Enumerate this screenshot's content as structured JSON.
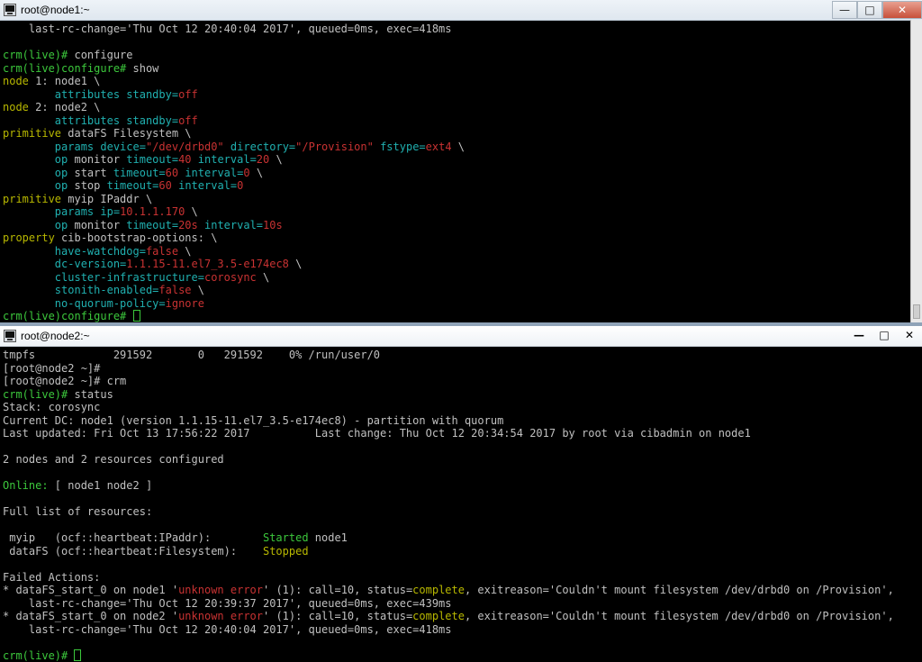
{
  "windows": [
    {
      "title": "root@node1:~",
      "controls": {
        "minimize": "—",
        "maximize": "□",
        "close": "✕"
      },
      "icon": "putty-terminal-icon",
      "lines": [
        [
          [
            "w",
            "    last-rc-change='Thu Oct 12 20:40:04 2017', queued=0ms, exec=418ms"
          ]
        ],
        [],
        [
          [
            "g",
            "crm(live)# "
          ],
          [
            "w",
            "configure"
          ]
        ],
        [
          [
            "g",
            "crm(live)configure# "
          ],
          [
            "w",
            "show"
          ]
        ],
        [
          [
            "y",
            "node "
          ],
          [
            "w",
            "1: node1 \\"
          ]
        ],
        [
          [
            "w",
            "        "
          ],
          [
            "c",
            "attributes "
          ],
          [
            "w",
            ""
          ],
          [
            "c",
            "standby="
          ],
          [
            "r",
            "off"
          ]
        ],
        [
          [
            "y",
            "node "
          ],
          [
            "w",
            "2: node2 \\"
          ]
        ],
        [
          [
            "w",
            "        "
          ],
          [
            "c",
            "attributes "
          ],
          [
            "c",
            "standby="
          ],
          [
            "r",
            "off"
          ]
        ],
        [
          [
            "y",
            "primitive "
          ],
          [
            "w",
            "dataFS Filesystem \\"
          ]
        ],
        [
          [
            "w",
            "        "
          ],
          [
            "c",
            "params "
          ],
          [
            "c",
            "device="
          ],
          [
            "r",
            "\"/dev/drbd0\""
          ],
          [
            "w",
            " "
          ],
          [
            "c",
            "directory="
          ],
          [
            "r",
            "\"/Provision\""
          ],
          [
            "w",
            " "
          ],
          [
            "c",
            "fstype="
          ],
          [
            "r",
            "ext4"
          ],
          [
            "w",
            " \\"
          ]
        ],
        [
          [
            "w",
            "        "
          ],
          [
            "c",
            "op "
          ],
          [
            "w",
            "monitor "
          ],
          [
            "c",
            "timeout="
          ],
          [
            "r",
            "40"
          ],
          [
            "w",
            " "
          ],
          [
            "c",
            "interval="
          ],
          [
            "r",
            "20"
          ],
          [
            "w",
            " \\"
          ]
        ],
        [
          [
            "w",
            "        "
          ],
          [
            "c",
            "op "
          ],
          [
            "w",
            "start "
          ],
          [
            "c",
            "timeout="
          ],
          [
            "r",
            "60"
          ],
          [
            "w",
            " "
          ],
          [
            "c",
            "interval="
          ],
          [
            "r",
            "0"
          ],
          [
            "w",
            " \\"
          ]
        ],
        [
          [
            "w",
            "        "
          ],
          [
            "c",
            "op "
          ],
          [
            "w",
            "stop "
          ],
          [
            "c",
            "timeout="
          ],
          [
            "r",
            "60"
          ],
          [
            "w",
            " "
          ],
          [
            "c",
            "interval="
          ],
          [
            "r",
            "0"
          ]
        ],
        [
          [
            "y",
            "primitive "
          ],
          [
            "w",
            "myip IPaddr \\"
          ]
        ],
        [
          [
            "w",
            "        "
          ],
          [
            "c",
            "params "
          ],
          [
            "c",
            "ip="
          ],
          [
            "r",
            "10.1.1.170"
          ],
          [
            "w",
            " \\"
          ]
        ],
        [
          [
            "w",
            "        "
          ],
          [
            "c",
            "op "
          ],
          [
            "w",
            "monitor "
          ],
          [
            "c",
            "timeout="
          ],
          [
            "r",
            "20s"
          ],
          [
            "w",
            " "
          ],
          [
            "c",
            "interval="
          ],
          [
            "r",
            "10s"
          ]
        ],
        [
          [
            "y",
            "property "
          ],
          [
            "w",
            "cib-bootstrap-options: \\"
          ]
        ],
        [
          [
            "w",
            "        "
          ],
          [
            "c",
            "have-watchdog="
          ],
          [
            "r",
            "false"
          ],
          [
            "w",
            " \\"
          ]
        ],
        [
          [
            "w",
            "        "
          ],
          [
            "c",
            "dc-version="
          ],
          [
            "r",
            "1.1.15-11.el7_3.5-e174ec8"
          ],
          [
            "w",
            " \\"
          ]
        ],
        [
          [
            "w",
            "        "
          ],
          [
            "c",
            "cluster-infrastructure="
          ],
          [
            "r",
            "corosync"
          ],
          [
            "w",
            " \\"
          ]
        ],
        [
          [
            "w",
            "        "
          ],
          [
            "c",
            "stonith-enabled="
          ],
          [
            "r",
            "false"
          ],
          [
            "w",
            " \\"
          ]
        ],
        [
          [
            "w",
            "        "
          ],
          [
            "c",
            "no-quorum-policy="
          ],
          [
            "r",
            "ignore"
          ]
        ],
        [
          [
            "g",
            "crm(live)configure# "
          ]
        ]
      ]
    },
    {
      "title": "root@node2:~",
      "controls": {
        "minimize": "—",
        "maximize": "□",
        "close": "✕"
      },
      "icon": "putty-terminal-icon",
      "lines": [
        [
          [
            "w",
            "tmpfs            291592       0   291592    0% /run/user/0"
          ]
        ],
        [
          [
            "w",
            "[root@node2 ~]#"
          ]
        ],
        [
          [
            "w",
            "[root@node2 ~]# crm"
          ]
        ],
        [
          [
            "g",
            "crm(live)# "
          ],
          [
            "w",
            "status"
          ]
        ],
        [
          [
            "w",
            "Stack: corosync"
          ]
        ],
        [
          [
            "w",
            "Current DC: node1 (version 1.1.15-11.el7_3.5-e174ec8) - partition with quorum"
          ]
        ],
        [
          [
            "w",
            "Last updated: Fri Oct 13 17:56:22 2017          Last change: Thu Oct 12 20:34:54 2017 by root via cibadmin on node1"
          ]
        ],
        [],
        [
          [
            "w",
            "2 nodes and 2 resources configured"
          ]
        ],
        [],
        [
          [
            "g",
            "Online: "
          ],
          [
            "w",
            "[ node1 node2 ]"
          ]
        ],
        [],
        [
          [
            "w",
            "Full list of resources:"
          ]
        ],
        [],
        [
          [
            "w",
            " myip   (ocf::heartbeat:IPaddr):        "
          ],
          [
            "g",
            "Started "
          ],
          [
            "w",
            "node1"
          ]
        ],
        [
          [
            "w",
            " dataFS (ocf::heartbeat:Filesystem):    "
          ],
          [
            "y",
            "Stopped"
          ]
        ],
        [],
        [
          [
            "w",
            "Failed Actions:"
          ]
        ],
        [
          [
            "w",
            "* dataFS_start_0 on node1 '"
          ],
          [
            "r",
            "unknown error"
          ],
          [
            "w",
            "' (1): call=10, status="
          ],
          [
            "y",
            "complete"
          ],
          [
            "w",
            ", exitreason='Couldn't mount filesystem /dev/drbd0 on /Provision',"
          ]
        ],
        [
          [
            "w",
            "    last-rc-change='Thu Oct 12 20:39:37 2017', queued=0ms, exec=439ms"
          ]
        ],
        [
          [
            "w",
            "* dataFS_start_0 on node2 '"
          ],
          [
            "r",
            "unknown error"
          ],
          [
            "w",
            "' (1): call=10, status="
          ],
          [
            "y",
            "complete"
          ],
          [
            "w",
            ", exitreason='Couldn't mount filesystem /dev/drbd0 on /Provision',"
          ]
        ],
        [
          [
            "w",
            "    last-rc-change='Thu Oct 12 20:40:04 2017', queued=0ms, exec=418ms"
          ]
        ],
        [],
        [
          [
            "g",
            "crm(live)# "
          ]
        ]
      ]
    }
  ]
}
